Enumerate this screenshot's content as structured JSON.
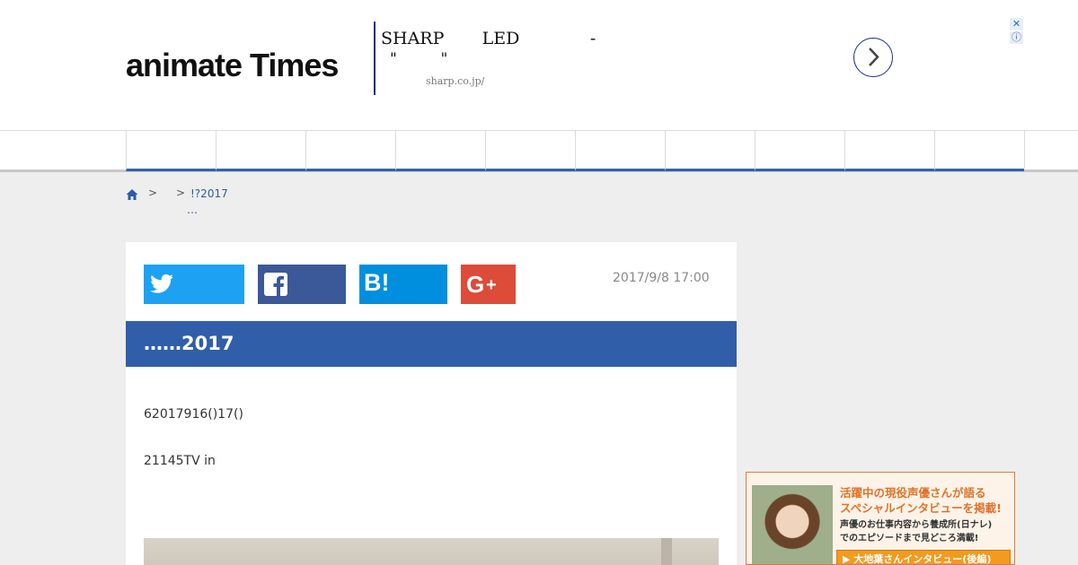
{
  "header": {
    "logo": "animate Times"
  },
  "ad": {
    "line1": "SHARP       LED             -",
    "line2": "\"         \"",
    "url": "sharp.co.jp/",
    "close": "✕",
    "info": "ⓘ"
  },
  "nav": {
    "items": [
      "",
      "",
      "",
      "",
      "",
      "",
      "",
      "",
      "",
      ""
    ]
  },
  "breadcrumb": {
    "sep1": ">",
    "sep2": ">",
    "current": "!?2017",
    "ellipsis": "…"
  },
  "article": {
    "date": "2017/9/8 17:00",
    "title": "……2017",
    "paragraph1": "62017916()17()",
    "paragraph2": "21145TV in"
  },
  "share": {
    "hatena_label": "B!"
  },
  "sidebar_ad": {
    "headline_line1": "活躍中の現役声優さんが語る",
    "headline_line2": "スペシャルインタビューを掲載!",
    "sub_line1": "声優のお仕事内容から養成所(日ナレ)",
    "sub_line2": "でのエピソードまで見どころ満載!",
    "button": "▶ 大地葉さんインタビュー(後編)"
  }
}
